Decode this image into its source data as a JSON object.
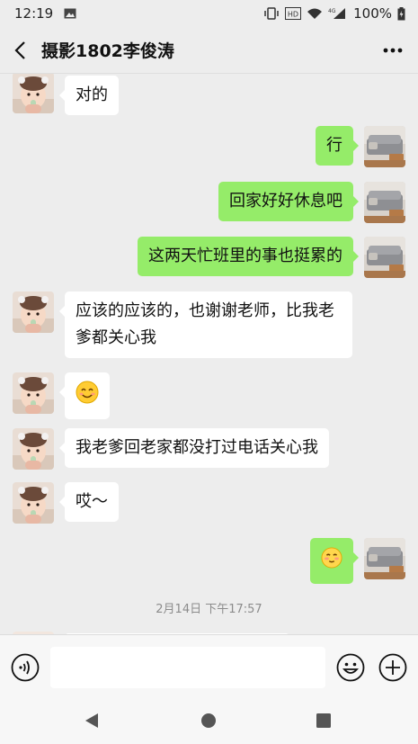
{
  "status_bar": {
    "time": "12:19",
    "battery": "100%",
    "network": "4G",
    "hd": "HD"
  },
  "header": {
    "title": "摄影1802李俊涛",
    "back_icon": "chevron-left-icon",
    "more_icon": "more-dots-icon"
  },
  "messages": [
    {
      "side": "in",
      "text": "对的"
    },
    {
      "side": "out",
      "text": "行"
    },
    {
      "side": "out",
      "text": "回家好好休息吧"
    },
    {
      "side": "out",
      "text": "这两天忙班里的事也挺累的"
    },
    {
      "side": "in",
      "text": "应该的应该的，也谢谢老师，比我老爹都关心我"
    },
    {
      "side": "in",
      "emoji": "smile-emoji"
    },
    {
      "side": "in",
      "text": "我老爹回老家都没打过电话关心我"
    },
    {
      "side": "in",
      "text": "哎～"
    },
    {
      "side": "out",
      "emoji": "blush-emoji"
    }
  ],
  "timestamp": "2月14日 下午17:57",
  "input": {
    "value": "",
    "voice_icon": "voice-icon",
    "emoji_icon": "emoji-icon",
    "plus_icon": "plus-icon"
  },
  "nav": {
    "back_icon": "nav-back-icon",
    "home_icon": "nav-home-icon",
    "recent_icon": "nav-recent-icon"
  },
  "colors": {
    "background": "#ededed",
    "bubble_out": "#95ec69",
    "bubble_in": "#ffffff",
    "timestamp": "#8c8c8c"
  }
}
